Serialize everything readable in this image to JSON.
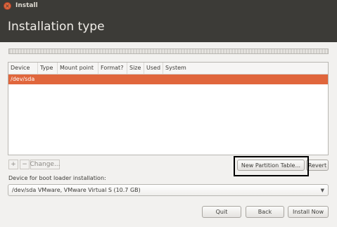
{
  "window": {
    "title": "Install",
    "close_glyph": "×"
  },
  "header": {
    "title": "Installation type"
  },
  "partition_table": {
    "columns": [
      "Device",
      "Type",
      "Mount point",
      "Format?",
      "Size",
      "Used",
      "System"
    ],
    "rows": [
      {
        "device": "/dev/sda",
        "selected": true
      }
    ]
  },
  "toolbar": {
    "add_label": "+",
    "remove_label": "−",
    "change_label": "Change...",
    "new_partition_table_label": "New Partition Table...",
    "revert_label": "Revert"
  },
  "boot_loader": {
    "label": "Device for boot loader installation:",
    "selected": "/dev/sda  VMware, VMware Virtual S (10.7 GB)"
  },
  "footer": {
    "quit_label": "Quit",
    "back_label": "Back",
    "install_label": "Install Now"
  },
  "colors": {
    "accent": "#e0663c",
    "titlebar": "#3c3b37"
  },
  "icons": {
    "close": "close-icon",
    "dropdown": "chevron-down-icon"
  }
}
